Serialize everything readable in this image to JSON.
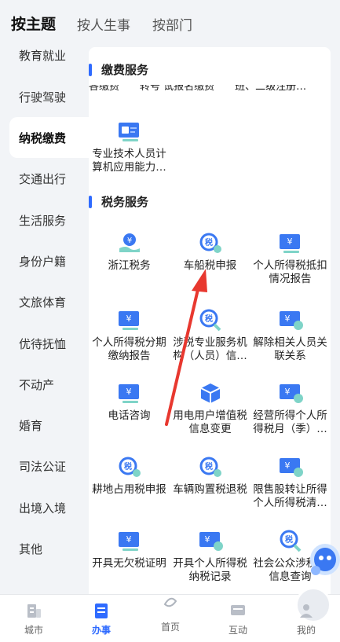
{
  "top_tabs": [
    {
      "label": "按主题",
      "active": true
    },
    {
      "label": "按人生事"
    },
    {
      "label": "按部门"
    }
  ],
  "sidebar": {
    "items": [
      {
        "label": "教育就业"
      },
      {
        "label": "行驶驾驶"
      },
      {
        "label": "纳税缴费",
        "active": true
      },
      {
        "label": "交通出行"
      },
      {
        "label": "生活服务"
      },
      {
        "label": "身份户籍"
      },
      {
        "label": "文旅体育"
      },
      {
        "label": "优待抚恤"
      },
      {
        "label": "不动产"
      },
      {
        "label": "婚育"
      },
      {
        "label": "司法公证"
      },
      {
        "label": "出境入境"
      },
      {
        "label": "其他"
      }
    ]
  },
  "sections": {
    "payment": {
      "title": "缴费服务",
      "cut_text": "各缴费　　转号 试报名缴费　　班、二级注册…",
      "items": [
        {
          "label": "专业技术人员计算机应用能力…",
          "icon": "id-card-icon"
        }
      ]
    },
    "tax": {
      "title": "税务服务",
      "items": [
        {
          "label": "浙江税务",
          "icon": "hand-coin-icon"
        },
        {
          "label": "车船税申报",
          "icon": "tax-refresh-icon"
        },
        {
          "label": "个人所得税抵扣情况报告",
          "icon": "id-card-icon"
        },
        {
          "label": "个人所得税分期缴纳报告",
          "icon": "id-card-icon"
        },
        {
          "label": "涉税专业服务机构（人员）信…",
          "icon": "tax-search-icon"
        },
        {
          "label": "解除相关人员关联关系",
          "icon": "ticket-icon"
        },
        {
          "label": "电话咨询",
          "icon": "id-card-icon"
        },
        {
          "label": "用电用户增值税信息变更",
          "icon": "box-icon"
        },
        {
          "label": "经营所得个人所得税月（季）…",
          "icon": "ticket-icon"
        },
        {
          "label": "耕地占用税申报",
          "icon": "tax-refresh-icon"
        },
        {
          "label": "车辆购置税退税",
          "icon": "tax-refresh-icon"
        },
        {
          "label": "限售股转让所得个人所得税清…",
          "icon": "ticket-icon"
        },
        {
          "label": "开具无欠税证明",
          "icon": "id-card-icon"
        },
        {
          "label": "开具个人所得税纳税记录",
          "icon": "ticket-icon"
        },
        {
          "label": "社会公众涉税开信息查询",
          "icon": "tax-search-icon"
        }
      ]
    }
  },
  "bottom_nav": [
    {
      "label": "城市",
      "icon": "city-icon"
    },
    {
      "label": "办事",
      "icon": "task-icon",
      "active": true
    },
    {
      "label": "首页",
      "icon": "home-icon"
    },
    {
      "label": "互动",
      "icon": "chat-icon"
    },
    {
      "label": "我的",
      "icon": "user-icon"
    }
  ],
  "colors": {
    "accent": "#2f6bff",
    "annotation_arrow": "#e8382f"
  }
}
